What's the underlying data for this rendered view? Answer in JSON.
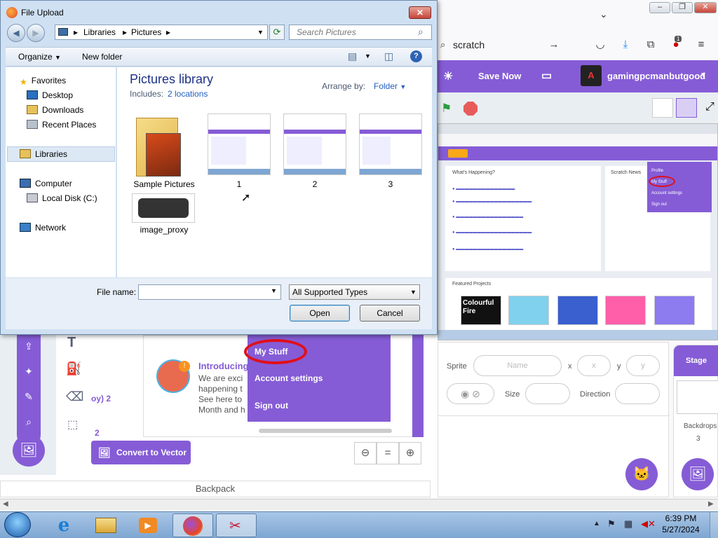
{
  "dialog": {
    "title": "File Upload",
    "breadcrumb": [
      "Libraries",
      "Pictures"
    ],
    "search_placeholder": "Search Pictures",
    "organize_label": "Organize",
    "new_folder_label": "New folder",
    "nav": {
      "favorites": "Favorites",
      "desktop": "Desktop",
      "downloads": "Downloads",
      "recent": "Recent Places",
      "libraries": "Libraries",
      "computer": "Computer",
      "local_disk": "Local Disk (C:)",
      "network": "Network"
    },
    "library_title": "Pictures library",
    "includes_label": "Includes:",
    "includes_link": "2 locations",
    "arrange_label": "Arrange by:",
    "arrange_value": "Folder",
    "files": [
      "Sample Pictures",
      "1",
      "2",
      "3",
      "image_proxy"
    ],
    "filename_label": "File name:",
    "filename_value": "",
    "filetype_value": "All Supported Types",
    "open_label": "Open",
    "cancel_label": "Cancel"
  },
  "browser": {
    "url_text": "scratch",
    "download_badge": "1"
  },
  "scratch": {
    "save_now": "Save Now",
    "username": "gamingpcmanbutgood",
    "dropdown": [
      "My Stuff",
      "Account settings",
      "Sign out"
    ],
    "news_title": "Introducing",
    "news_lines": [
      "We are exci",
      "happening t",
      "See here to",
      "Month and h"
    ],
    "left_labels": [
      "oy) 2",
      "2"
    ],
    "convert_label": "Convert to Vector",
    "backpack_label": "Backpack",
    "sprite_label": "Sprite",
    "name_placeholder": "Name",
    "x_label": "x",
    "y_label": "y",
    "x_placeholder": "x",
    "y_placeholder": "y",
    "size_label": "Size",
    "direction_label": "Direction",
    "stage_label": "Stage",
    "backdrops_label": "Backdrops",
    "backdrops_count": "3"
  },
  "stage_screenshot": {
    "whats_happening": "What's Happening?",
    "scratch_news": "Scratch News",
    "featured": "Featured Projects",
    "featured_caption": "Colourful Fire",
    "menu": [
      "Profile",
      "My Stuff",
      "Account settings",
      "Sign out"
    ]
  },
  "taskbar": {
    "time": "6:39 PM",
    "date": "5/27/2024"
  },
  "colors": {
    "scratch_purple": "#855cd6",
    "highlight_red": "#e0101a",
    "dialog_blue": "#1e3287"
  }
}
